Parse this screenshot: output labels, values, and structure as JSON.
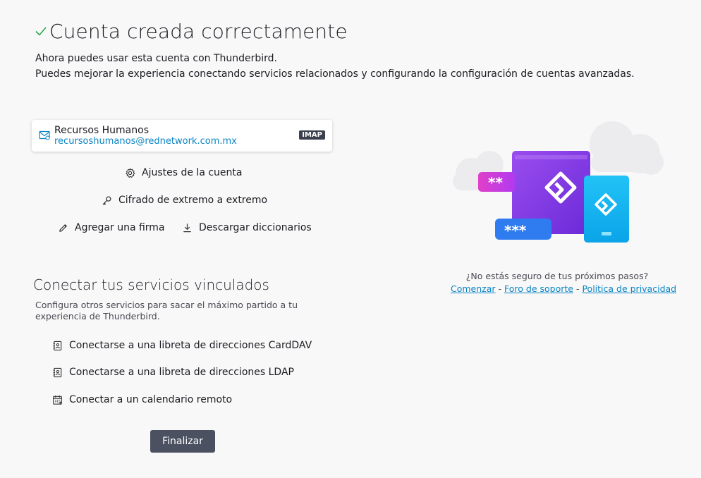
{
  "header": {
    "title": "Cuenta creada correctamente",
    "line1": "Ahora puedes usar esta cuenta con Thunderbird.",
    "line2": "Puedes mejorar la experiencia conectando servicios relacionados y configurando la configuración de cuentas avanzadas."
  },
  "account": {
    "name": "Recursos Humanos",
    "email": "recursoshumanos@rednetwork.com.mx",
    "protocol": "IMAP"
  },
  "actions": {
    "settings": "Ajustes de la cuenta",
    "e2e": "Cifrado de extremo a extremo",
    "signature": "Agregar una firma",
    "dictionaries": "Descargar diccionarios"
  },
  "connect": {
    "title": "Conectar tus servicios vinculados",
    "description": "Configura otros servicios para sacar el máximo partido a tu experiencia de Thunderbird.",
    "services": {
      "carddav": "Conectarse a una libreta de direcciones CardDAV",
      "ldap": "Conectarse a una libreta de direcciones LDAP",
      "calendar": "Conectar a un calendario remoto"
    }
  },
  "finish_button": "Finalizar",
  "help": {
    "question": "¿No estás seguro de tus próximos pasos?",
    "links": {
      "start": "Comenzar",
      "support": "Foro de soporte",
      "privacy": "Política de privacidad"
    },
    "separator": "-"
  },
  "illustration": {
    "password_masks": [
      "**",
      "***"
    ]
  },
  "colors": {
    "accent": "#0a84c4",
    "check": "#2ea44f",
    "button": "#4b5161",
    "purple": "#8a3ce8",
    "cyan": "#12b5f0",
    "pink": "#d03ad6",
    "blue": "#2f7cf0"
  },
  "icons": {
    "check": "check-icon",
    "account": "mail-account-icon",
    "settings": "gear-icon",
    "e2e": "key-icon",
    "signature": "pencil-icon",
    "dictionaries": "download-icon",
    "carddav": "address-book-icon",
    "ldap": "address-book-icon",
    "calendar": "calendar-icon"
  }
}
